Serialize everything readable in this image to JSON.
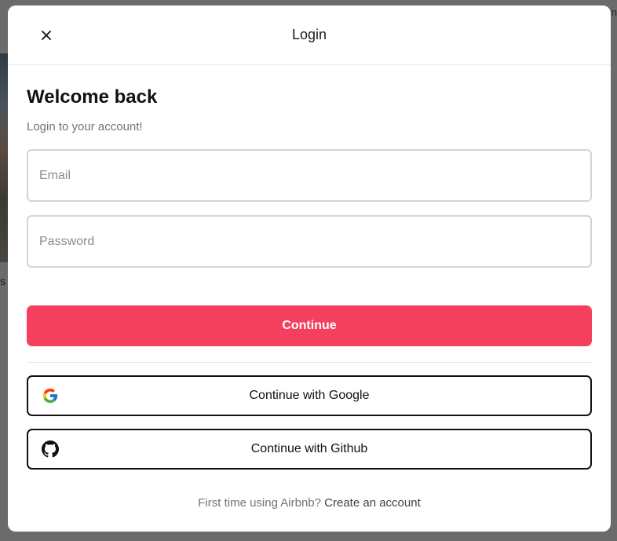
{
  "background": {
    "left_text": "s",
    "right_text": "n"
  },
  "modal": {
    "title": "Login",
    "close_icon": "close-icon",
    "heading": "Welcome back",
    "subheading": "Login to your account!",
    "email": {
      "placeholder": "Email",
      "value": ""
    },
    "password": {
      "placeholder": "Password",
      "value": ""
    },
    "continue_label": "Continue",
    "google_label": "Continue with Google",
    "github_label": "Continue with Github",
    "footer": {
      "prompt": "First time using Airbnb?",
      "link": "Create an account"
    }
  },
  "colors": {
    "accent": "#f43f5e",
    "overlay": "#6b6b6b",
    "text": "#111111",
    "muted": "#737373"
  }
}
